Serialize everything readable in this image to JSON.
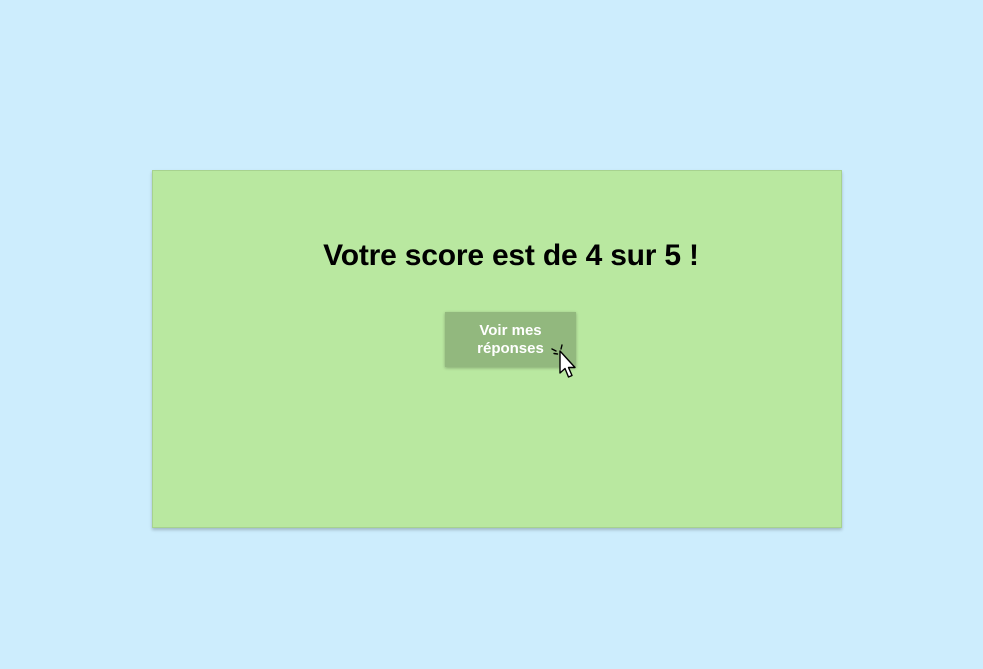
{
  "score_card": {
    "title": "Votre score est de 4 sur 5 !",
    "view_answers_label": "Voir mes réponses"
  },
  "colors": {
    "background": "#cdedfd",
    "card": "#b9e8a0",
    "button": "#92b87e",
    "button_text": "#ffffff",
    "title_text": "#000000"
  },
  "icons": {
    "cursor": "click-cursor-icon"
  }
}
